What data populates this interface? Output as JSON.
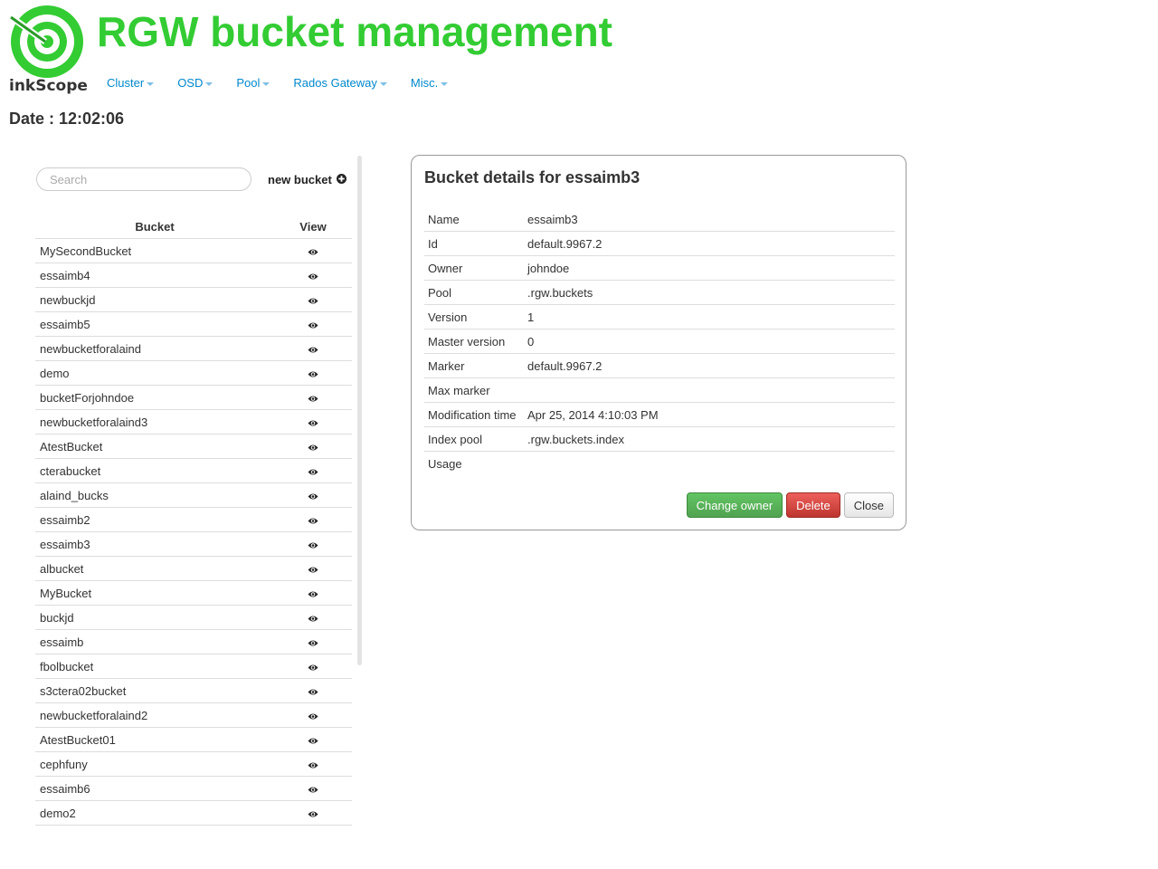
{
  "app": {
    "logo_text": "inkScope",
    "title": "RGW bucket management"
  },
  "nav": {
    "items": [
      {
        "label": "Cluster"
      },
      {
        "label": "OSD"
      },
      {
        "label": "Pool"
      },
      {
        "label": "Rados Gateway"
      },
      {
        "label": "Misc."
      }
    ]
  },
  "date": {
    "label": "Date : ",
    "value": "12:02:06"
  },
  "bucket_list": {
    "search_placeholder": "Search",
    "new_bucket_label": "new bucket",
    "col_bucket": "Bucket",
    "col_view": "View",
    "rows": [
      "MySecondBucket",
      "essaimb4",
      "newbuckjd",
      "essaimb5",
      "newbucketforalaind",
      "demo",
      "bucketForjohndoe",
      "newbucketforalaind3",
      "AtestBucket",
      "cterabucket",
      "alaind_bucks",
      "essaimb2",
      "essaimb3",
      "albucket",
      "MyBucket",
      "buckjd",
      "essaimb",
      "fbolbucket",
      "s3ctera02bucket",
      "newbucketforalaind2",
      "AtestBucket01",
      "cephfuny",
      "essaimb6",
      "demo2"
    ]
  },
  "details": {
    "title": "Bucket details for essaimb3",
    "fields": [
      {
        "key": "Name",
        "value": "essaimb3"
      },
      {
        "key": "Id",
        "value": "default.9967.2"
      },
      {
        "key": "Owner",
        "value": "johndoe"
      },
      {
        "key": "Pool",
        "value": ".rgw.buckets"
      },
      {
        "key": "Version",
        "value": "1"
      },
      {
        "key": "Master version",
        "value": "0"
      },
      {
        "key": "Marker",
        "value": "default.9967.2"
      },
      {
        "key": "Max marker",
        "value": ""
      },
      {
        "key": "Modification time",
        "value": "Apr 25, 2014 4:10:03 PM"
      },
      {
        "key": "Index pool",
        "value": ".rgw.buckets.index"
      },
      {
        "key": "Usage",
        "value": ""
      }
    ],
    "buttons": {
      "change_owner": "Change owner",
      "delete": "Delete",
      "close": "Close"
    }
  },
  "colors": {
    "brand_green": "#33cc33",
    "link_blue": "#0088cc",
    "success": "#5bb75b",
    "danger": "#da4f49"
  },
  "icons": {
    "logo": "target-logo-icon",
    "new_bucket": "plus-circle-icon",
    "view": "eye-icon",
    "nav_caret": "caret-down-icon"
  }
}
